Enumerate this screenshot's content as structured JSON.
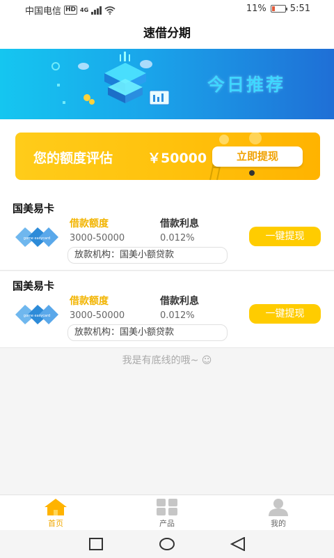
{
  "status_bar": {
    "carrier": "中国电信",
    "hd": "HD",
    "network": "4G",
    "battery": "11%",
    "time": "5:51"
  },
  "header": {
    "title": "速借分期"
  },
  "banner": {
    "title": "今日推荐"
  },
  "quota": {
    "label": "您的额度评估",
    "amount": "￥50000",
    "button": "立即提现"
  },
  "products": [
    {
      "name": "国美易卡",
      "amount_label": "借款额度",
      "amount_value": "3000-50000",
      "interest_label": "借款利息",
      "interest_value": "0.012%",
      "institution": "放款机构：国美小额贷款",
      "button": "一键提现",
      "logo_icon": "gome-easycard-logo-icon"
    },
    {
      "name": "国美易卡",
      "amount_label": "借款额度",
      "amount_value": "3000-50000",
      "interest_label": "借款利息",
      "interest_value": "0.012%",
      "institution": "放款机构：国美小额贷款",
      "button": "一键提现",
      "logo_icon": "gome-easycard-logo-icon"
    }
  ],
  "footer_note": "我是有底线的哦~ ☺",
  "tabs": [
    {
      "label": "首页",
      "icon": "home-icon",
      "active": true
    },
    {
      "label": "产品",
      "icon": "grid-icon",
      "active": false
    },
    {
      "label": "我的",
      "icon": "user-icon",
      "active": false
    }
  ],
  "nav": {
    "icons": [
      "square-icon",
      "circle-icon",
      "back-triangle-icon"
    ]
  },
  "colors": {
    "accent": "#ffcc00",
    "accent_text": "#f2b400",
    "banner": "#1aa4ea"
  }
}
